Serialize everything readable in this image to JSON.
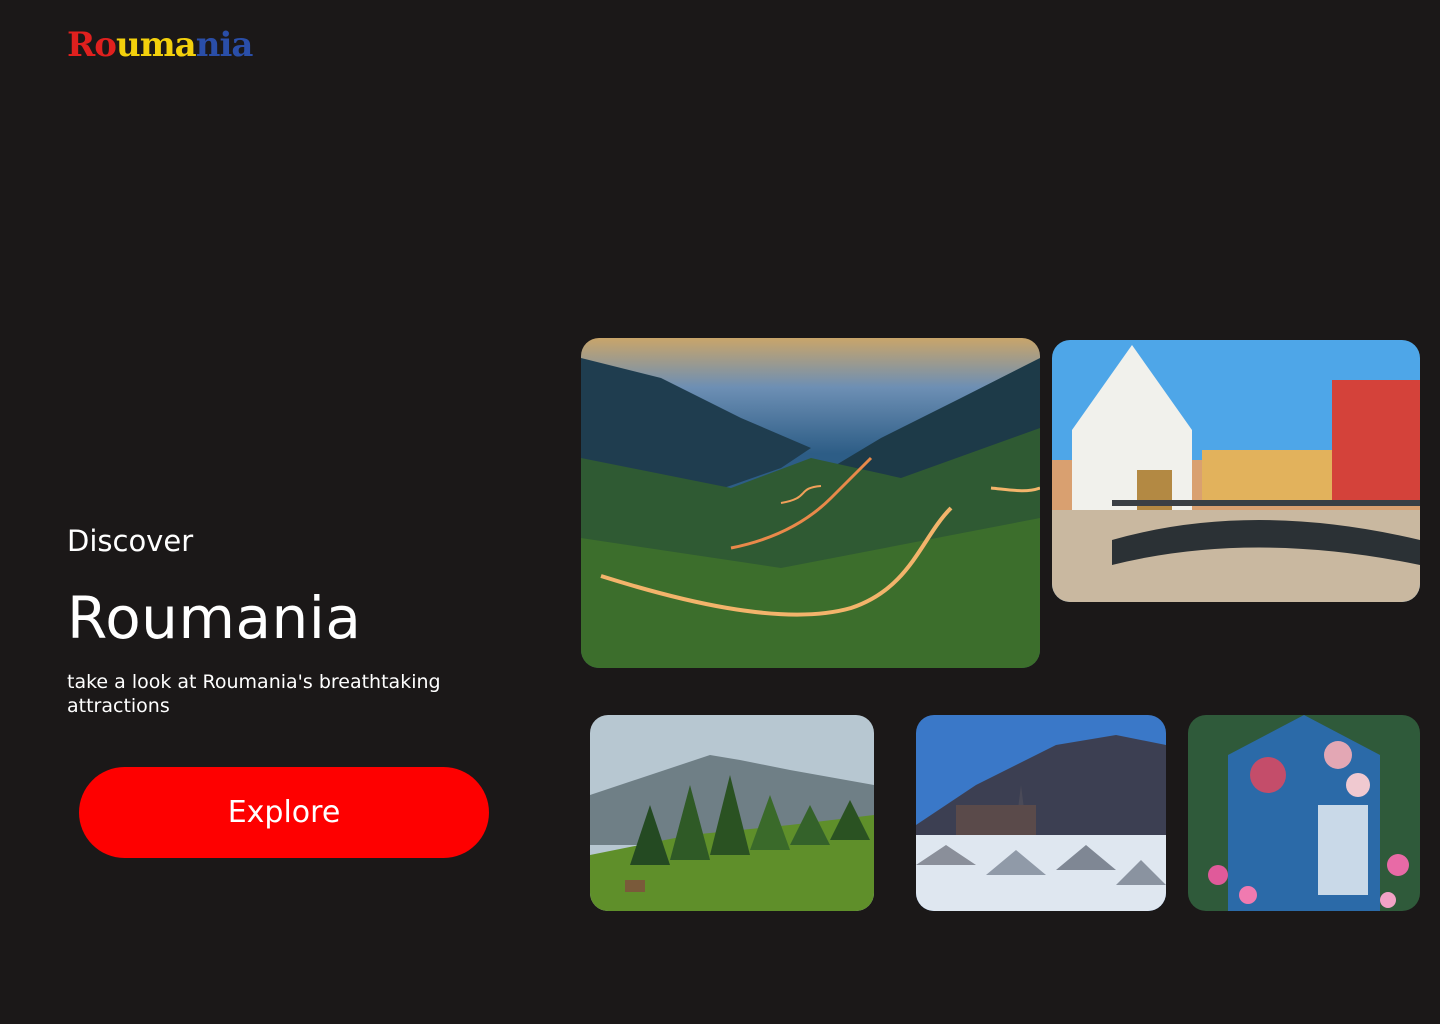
{
  "brand": {
    "letters": [
      {
        "char": "R",
        "color": "#e0201e"
      },
      {
        "char": "o",
        "color": "#e0201e"
      },
      {
        "char": "u",
        "color": "#f3d00c"
      },
      {
        "char": "m",
        "color": "#f3d00c"
      },
      {
        "char": "a",
        "color": "#f3d00c"
      },
      {
        "char": "n",
        "color": "#2a4ea8"
      },
      {
        "char": "i",
        "color": "#2a4ea8"
      },
      {
        "char": "a",
        "color": "#2a4ea8"
      }
    ]
  },
  "hero": {
    "eyebrow": "Discover",
    "title": "Roumania",
    "tagline": "take a look at Roumania's breathtaking attractions",
    "cta_label": "Explore"
  },
  "gallery": [
    {
      "subject": "mountain-road-photo"
    },
    {
      "subject": "old-town-bridge-photo"
    },
    {
      "subject": "forest-hill-photo"
    },
    {
      "subject": "snowy-town-photo"
    },
    {
      "subject": "painted-cross-photo"
    }
  ],
  "colors": {
    "background": "#1b1818",
    "accent": "#fe0000",
    "text": "#ffffff"
  }
}
